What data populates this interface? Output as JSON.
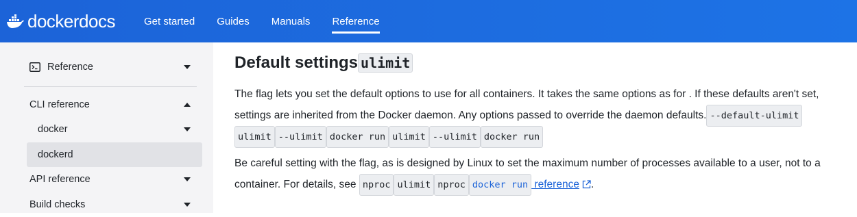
{
  "brand": {
    "name_part1": "docker",
    "name_part2": "docs"
  },
  "nav": [
    {
      "label": "Get started",
      "active": false
    },
    {
      "label": "Guides",
      "active": false
    },
    {
      "label": "Manuals",
      "active": false
    },
    {
      "label": "Reference",
      "active": true
    }
  ],
  "sidebar": {
    "section": {
      "label": "Reference",
      "icon": "terminal-icon"
    },
    "items": [
      {
        "label": "CLI reference",
        "expanded": true
      },
      {
        "label": "docker",
        "expanded": false
      },
      {
        "label": "dockerd",
        "selected": true
      },
      {
        "label": "API reference",
        "expanded": false
      },
      {
        "label": "Build checks",
        "expanded": false
      }
    ]
  },
  "content": {
    "title_text": "Default settings",
    "title_code": "ulimit",
    "p1_line1": "The flag lets you set the default options to use for all containers. It takes the same options as for . If these defaults aren't set,",
    "p1_line2": "settings are inherited from the Docker daemon. Any options passed to override the daemon defaults.",
    "p1_code_default_ulimit": "--default-ulimit",
    "p1_codes": [
      "ulimit",
      "--ulimit",
      "docker run",
      "ulimit",
      "--ulimit",
      "docker run"
    ],
    "p2_line1": "Be careful setting with the flag, as is designed by Linux to set the maximum number of processes available to a user, not to a",
    "p2_line2_start": "container. For details, see",
    "p2_codes": [
      "nproc",
      "ulimit",
      "nproc"
    ],
    "p2_link_code": "docker run",
    "p2_link_text": " reference",
    "p2_end": "."
  },
  "colors": {
    "header": "#1c63d8",
    "link": "#1c63d8",
    "sidebar_bg": "#f4f4f6"
  }
}
